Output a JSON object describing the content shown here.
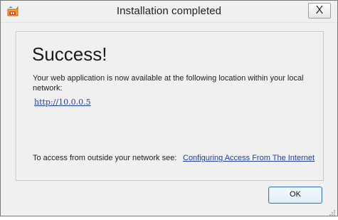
{
  "window": {
    "title": "Installation completed",
    "close_glyph": "X",
    "app_icon": "installer-app-icon"
  },
  "content": {
    "heading": "Success!",
    "message": "Your web application is now available at the following location within your local network:",
    "location_link": "http://10.0.0.5",
    "outside_text": "To access from outside your network see:",
    "internet_link": "Configuring Access From The Internet"
  },
  "buttons": {
    "ok_label": "OK"
  },
  "colors": {
    "link": "#1f3ea8",
    "window_bg": "#f0f0f0",
    "ok_border": "#3c7fb1"
  }
}
